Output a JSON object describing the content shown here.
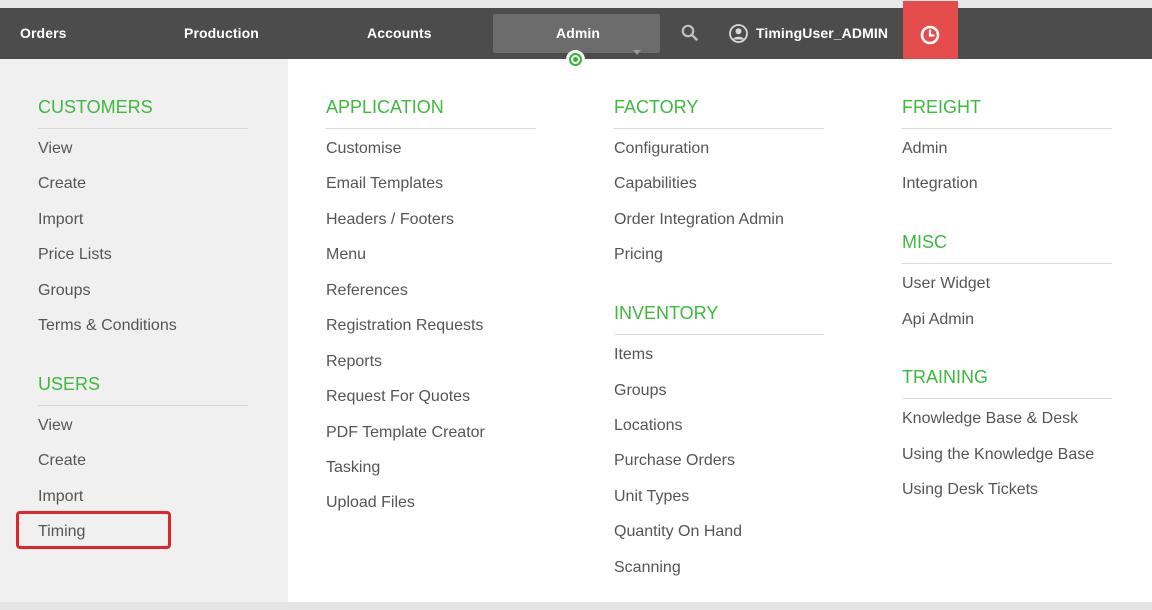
{
  "nav": {
    "orders": "Orders",
    "production": "Production",
    "accounts": "Accounts",
    "admin": "Admin",
    "user": "TimingUser_ADMIN"
  },
  "icons": {
    "admin_caret": "chevron-down-icon",
    "search": "search-icon",
    "user": "user-circle-icon",
    "clock": "clock-icon"
  },
  "colors": {
    "navbar": "#4c4c4c",
    "admin_active": "#6c6c6c",
    "clock_button": "#e54c4c",
    "section_heading": "#3db93d",
    "highlight": "#e0252c"
  },
  "menu": {
    "customers": {
      "title": "CUSTOMERS",
      "items": [
        "View",
        "Create",
        "Import",
        "Price Lists",
        "Groups",
        "Terms & Conditions"
      ]
    },
    "users": {
      "title": "USERS",
      "items": [
        "View",
        "Create",
        "Import",
        "Timing"
      ]
    },
    "application": {
      "title": "APPLICATION",
      "items": [
        "Customise",
        "Email Templates",
        "Headers / Footers",
        "Menu",
        "References",
        "Registration Requests",
        "Reports",
        "Request For Quotes",
        "PDF Template Creator",
        "Tasking",
        "Upload Files"
      ]
    },
    "factory": {
      "title": "FACTORY",
      "items": [
        "Configuration",
        "Capabilities",
        "Order Integration Admin",
        "Pricing"
      ]
    },
    "inventory": {
      "title": "INVENTORY",
      "items": [
        "Items",
        "Groups",
        "Locations",
        "Purchase Orders",
        "Unit Types",
        "Quantity On Hand",
        "Scanning"
      ]
    },
    "freight": {
      "title": "FREIGHT",
      "items": [
        "Admin",
        "Integration"
      ]
    },
    "misc": {
      "title": "MISC",
      "items": [
        "User Widget",
        "Api Admin"
      ]
    },
    "training": {
      "title": "TRAINING",
      "items": [
        "Knowledge Base & Desk",
        "Using the Knowledge Base",
        "Using Desk Tickets"
      ]
    }
  },
  "highlighted_item": "Timing"
}
